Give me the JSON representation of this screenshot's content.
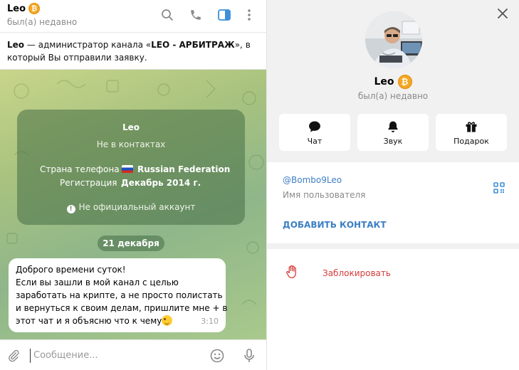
{
  "chat_header": {
    "name": "Leo",
    "badge": "₿",
    "status": "был(а) недавно"
  },
  "notice": {
    "name": "Leo",
    "text_mid": " — администратор канала «",
    "channel": "LEO - АРБИТРАЖ",
    "text_end": "», в который Вы отправили заявку."
  },
  "info_card": {
    "name": "Leo",
    "contact_status": "Не в контактах",
    "phone_country_label": "Страна телефона",
    "phone_country_value": "Russian Federation",
    "registration_label": "Регистрация",
    "registration_value": "Декабрь 2014 г.",
    "unofficial": "Не официальный аккаунт"
  },
  "date_pill": "21 декабря",
  "message": {
    "lines": [
      "Доброго времени суток!",
      "Если вы зашли в мой канал с целью",
      "заработать на крипте, а не просто полистать",
      "и вернуться к своим делам, пришлите мне + в",
      "этот чат и я объясню что к чему"
    ],
    "time": "3:10"
  },
  "composer": {
    "placeholder": "Сообщение..."
  },
  "profile": {
    "name": "Leo",
    "status": "был(а) недавно",
    "actions": [
      {
        "label": "Чат",
        "icon": "chat-icon"
      },
      {
        "label": "Звук",
        "icon": "bell-icon"
      },
      {
        "label": "Подарок",
        "icon": "gift-icon"
      }
    ],
    "username": "@Bombo9Leo",
    "username_caption": "Имя пользователя",
    "add_contact": "ДОБАВИТЬ КОНТАКТ",
    "block": "Заблокировать"
  },
  "colors": {
    "accent": "#3d7fc4",
    "danger": "#d63b3b",
    "badge": "#f5a623"
  }
}
